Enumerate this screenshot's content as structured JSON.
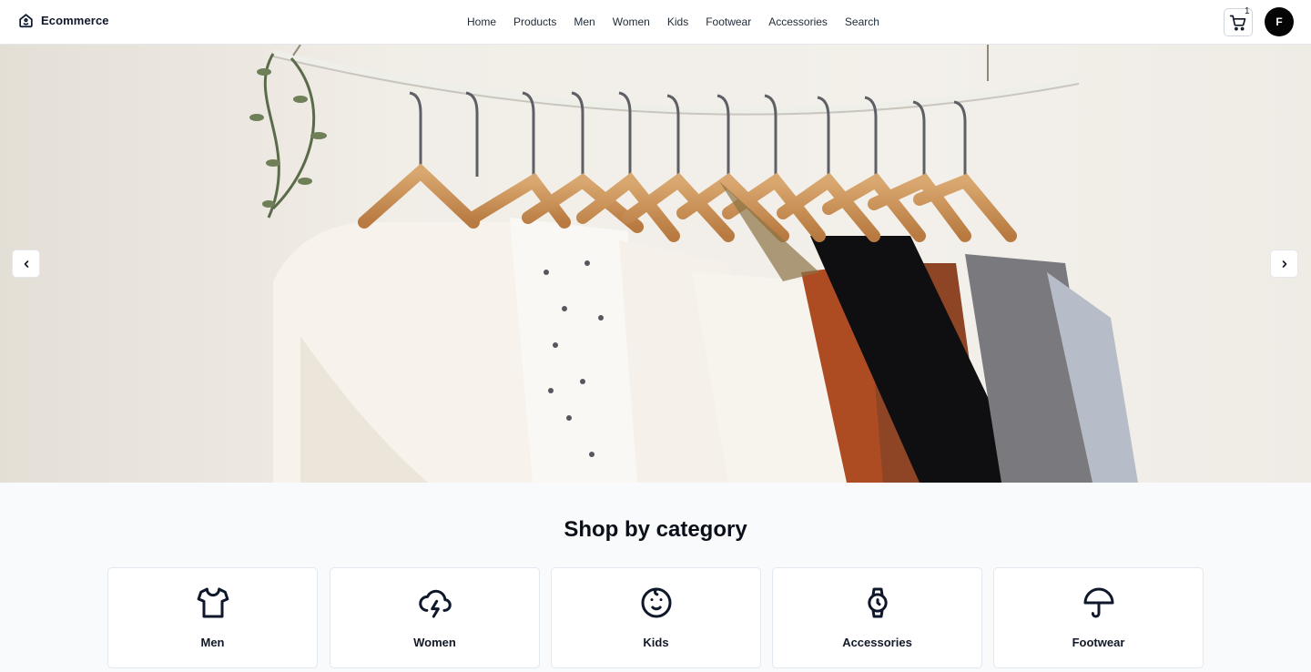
{
  "brand": {
    "name": "Ecommerce",
    "icon": "home-icon"
  },
  "nav": {
    "items": [
      {
        "label": "Home"
      },
      {
        "label": "Products"
      },
      {
        "label": "Men"
      },
      {
        "label": "Women"
      },
      {
        "label": "Kids"
      },
      {
        "label": "Footwear"
      },
      {
        "label": "Accessories"
      },
      {
        "label": "Search"
      }
    ]
  },
  "cart": {
    "icon": "shopping-cart-icon",
    "count": "1"
  },
  "user": {
    "avatar_initial": "F"
  },
  "hero": {
    "image": "clothes-on-hangers-rack",
    "prev_icon": "chevron-left-icon",
    "next_icon": "chevron-right-icon"
  },
  "categories": {
    "title": "Shop by category",
    "items": [
      {
        "label": "Men",
        "icon": "shirt-icon"
      },
      {
        "label": "Women",
        "icon": "cloud-lightning-icon"
      },
      {
        "label": "Kids",
        "icon": "baby-face-icon"
      },
      {
        "label": "Accessories",
        "icon": "watch-icon"
      },
      {
        "label": "Footwear",
        "icon": "umbrella-icon"
      }
    ]
  },
  "colors": {
    "accent": "#050505",
    "page_background": "#f8fafc",
    "header_background": "#ffffff",
    "card_border": "#e2e8f0"
  }
}
